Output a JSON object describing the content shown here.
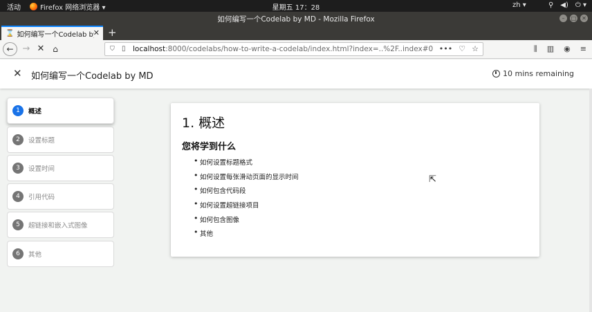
{
  "system": {
    "activities": "活动",
    "app": "Firefox 网络浏览器 ▾",
    "clock": "星期五 17：28",
    "lang": "zh ▾",
    "tray_icons": [
      "accessibility-icon",
      "volume-icon",
      "power-icon"
    ]
  },
  "window": {
    "title": "如何编写一个Codelab by MD - Mozilla Firefox"
  },
  "tab": {
    "label": "如何编写一个Codelab by MD",
    "close": "✕",
    "new_tab": "+"
  },
  "nav": {
    "back": "←",
    "forward": "→",
    "stop": "✕",
    "home": "⌂",
    "url_host": "localhost",
    "url_path": ":8000/codelabs/how-to-write-a-codelab/index.html?index=..%2F..index#0",
    "more": "•••"
  },
  "codelab": {
    "title": "如何编写一个Codelab by MD",
    "remaining": "10 mins remaining",
    "steps": [
      {
        "num": "1",
        "label": "概述"
      },
      {
        "num": "2",
        "label": "设置标题"
      },
      {
        "num": "3",
        "label": "设置时间"
      },
      {
        "num": "4",
        "label": "引用代码"
      },
      {
        "num": "5",
        "label": "超链接和嵌入式图像"
      },
      {
        "num": "6",
        "label": "其他"
      }
    ],
    "active_step": 1,
    "content": {
      "heading": "1. 概述",
      "subheading": "您将学到什么",
      "items": [
        "如何设置标题格式",
        "如何设置每张滑动页面的显示时间",
        "如何包含代码段",
        "如何设置超链接项目",
        "如何包含图像",
        "其他"
      ]
    }
  },
  "colors": {
    "accent": "#1a73e8",
    "tab_indicator": "#0a84ff",
    "title_bar": "#3b3a37"
  }
}
